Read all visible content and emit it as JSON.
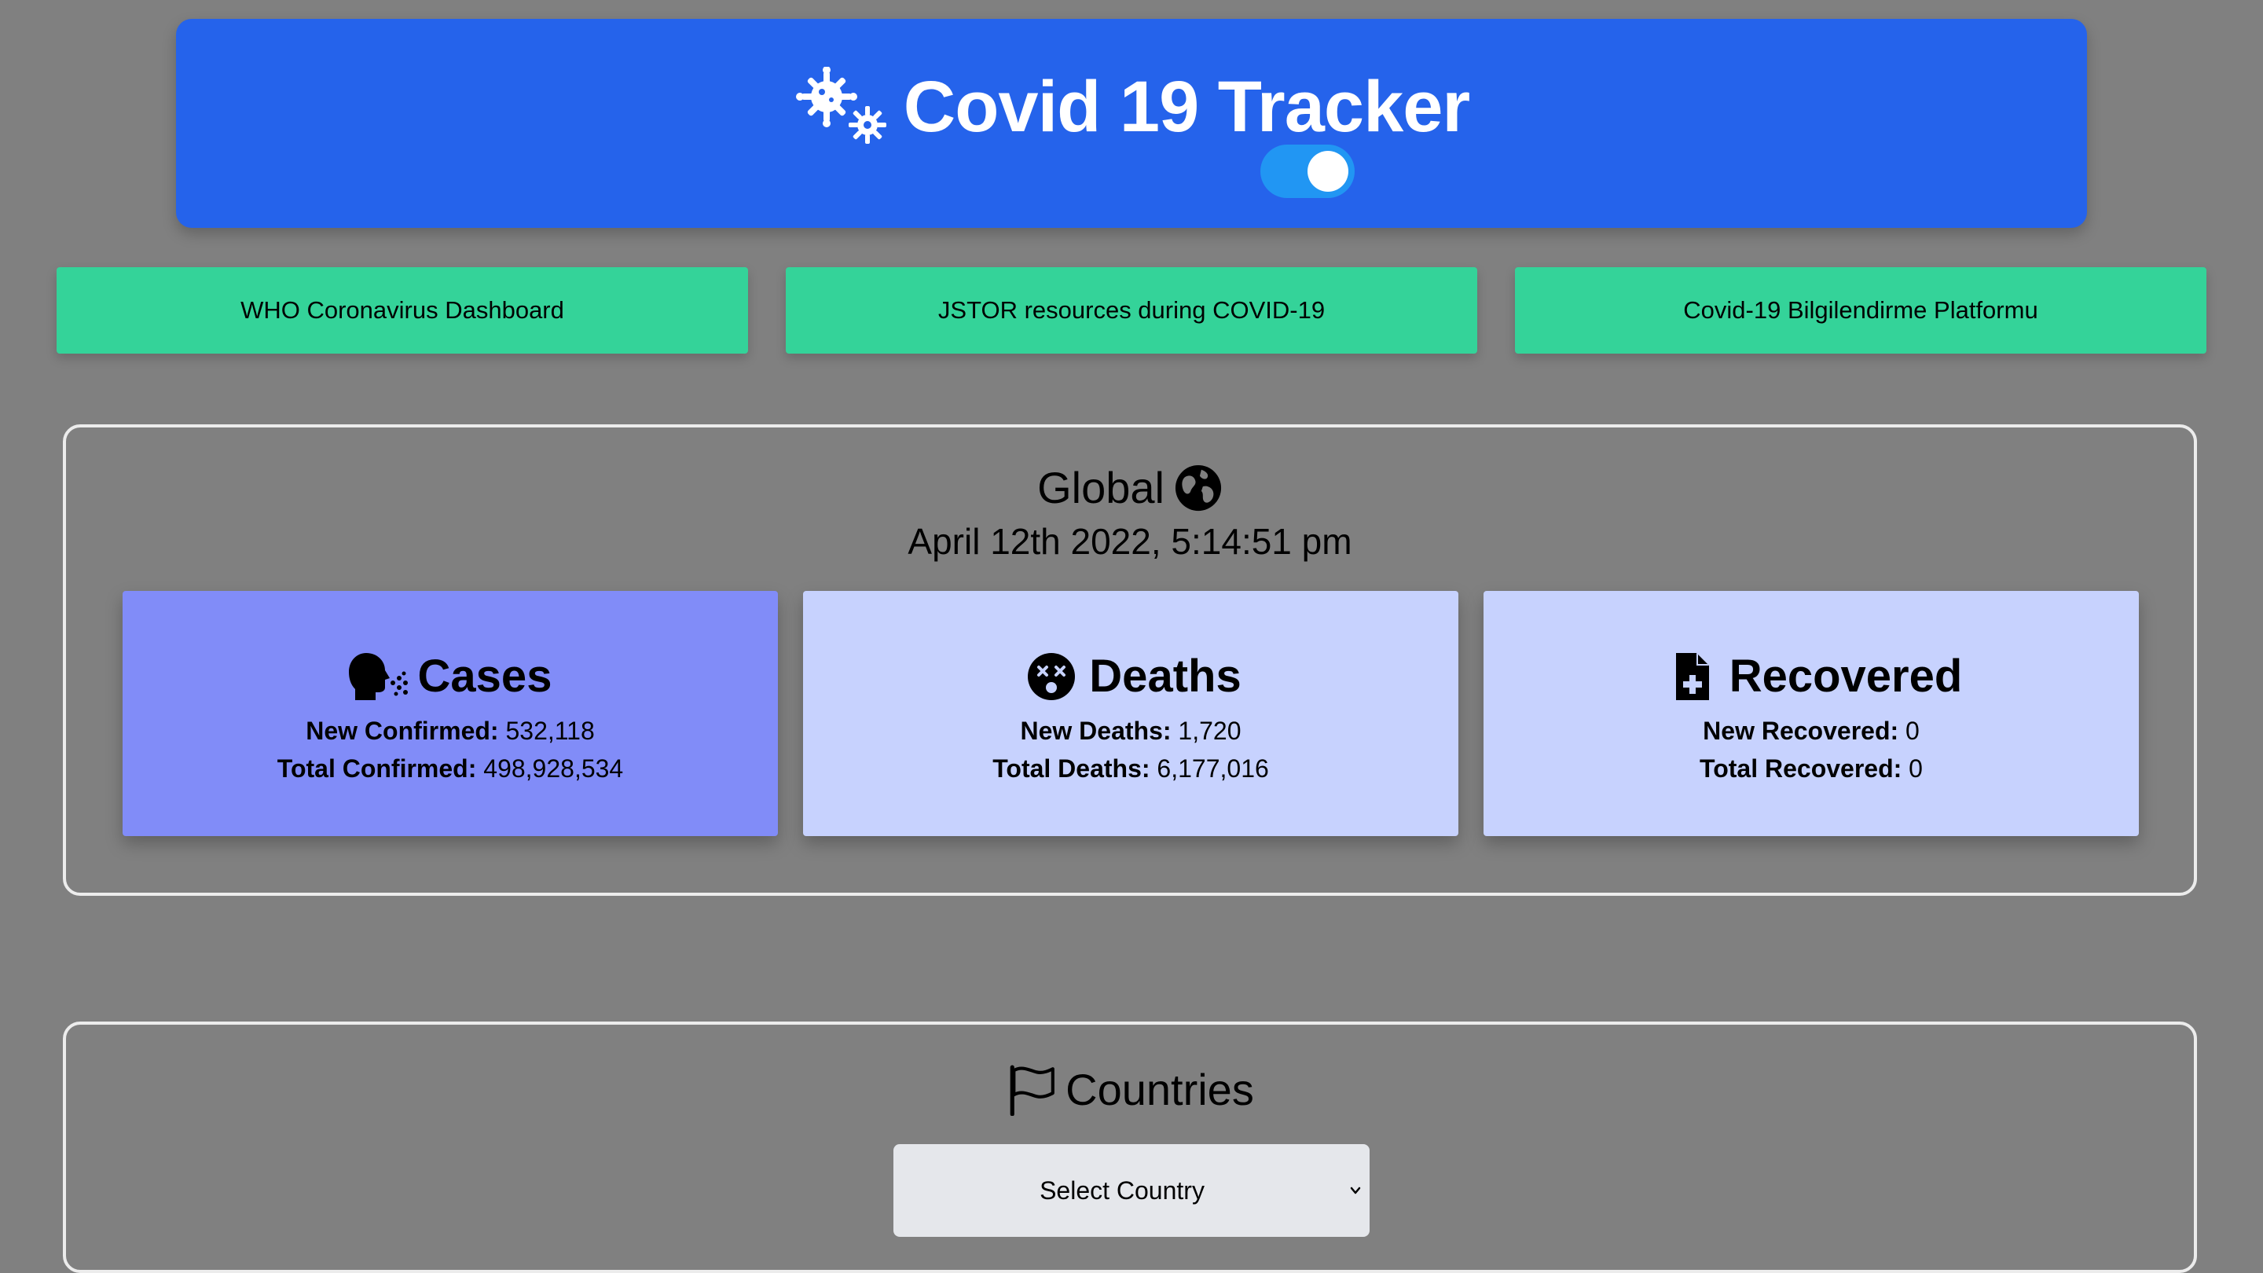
{
  "header": {
    "title": "Covid 19 Tracker",
    "icon": "virus-icon",
    "theme_toggle_on": true
  },
  "links": [
    {
      "label": "WHO Coronavirus Dashboard"
    },
    {
      "label": "JSTOR resources during COVID-19"
    },
    {
      "label": "Covid-19 Bilgilendirme Platformu"
    }
  ],
  "global": {
    "title": "Global",
    "icon": "globe-icon",
    "date": "April 12th 2022, 5:14:51 pm",
    "cards": {
      "cases": {
        "title": "Cases",
        "icon": "head-cough-icon",
        "line1_label": "New Confirmed:",
        "line1_value": "532,118",
        "line2_label": "Total Confirmed:",
        "line2_value": "498,928,534"
      },
      "deaths": {
        "title": "Deaths",
        "icon": "dizzy-face-icon",
        "line1_label": "New Deaths:",
        "line1_value": "1,720",
        "line2_label": "Total Deaths:",
        "line2_value": "6,177,016"
      },
      "recovered": {
        "title": "Recovered",
        "icon": "medical-file-icon",
        "line1_label": "New Recovered:",
        "line1_value": "0",
        "line2_label": "Total Recovered:",
        "line2_value": "0"
      }
    }
  },
  "countries": {
    "title": "Countries",
    "icon": "flag-icon",
    "select_value": "Select Country"
  },
  "colors": {
    "background": "#808080",
    "header": "#2563eb",
    "toggle": "#2196f3",
    "link_button": "#34d399",
    "card_active": "#818cf8",
    "card": "#c7d2fe",
    "select": "#e5e7eb"
  }
}
